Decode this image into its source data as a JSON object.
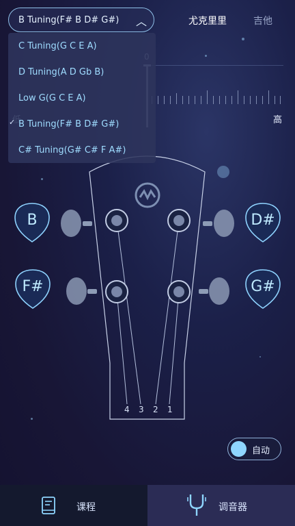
{
  "header": {
    "selected_tuning": "B Tuning(F# B D# G#)",
    "instruments": [
      "尤克里里",
      "吉他"
    ]
  },
  "dropdown": {
    "options": [
      "C Tuning(G C E A)",
      "D Tuning(A D Gb B)",
      "Low G(G C E A)",
      "B Tuning(F# B D# G#)",
      "C# Tuning(G# C# F A#)"
    ],
    "checked_index": 3
  },
  "meter": {
    "zero_label": "0",
    "low_label": "低",
    "high_label": "高"
  },
  "pegs": {
    "left_top": "B",
    "left_bottom": "F#",
    "right_top": "D#",
    "right_bottom": "G#"
  },
  "string_numbers": [
    "4",
    "3",
    "2",
    "1"
  ],
  "auto_toggle": {
    "label": "自动",
    "on": true
  },
  "nav": {
    "course_label": "课程",
    "tuner_label": "调音器"
  },
  "colors": {
    "accent": "#8fd6ff",
    "pick_outline": "#8fd3ff",
    "background": "#1b2049"
  }
}
